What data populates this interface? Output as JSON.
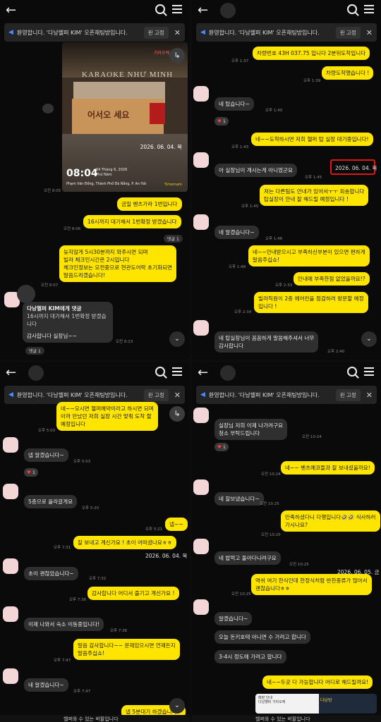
{
  "notice": {
    "text": "환영합니다. '다낭헬퍼 KIM' 오픈채팅방입니다.",
    "pin_label": "핀 고정",
    "close": "✕"
  },
  "icons": {
    "back": "←",
    "down": "⌄",
    "share": "↳"
  },
  "panel1": {
    "photo": {
      "sign": "KARAOKE NHƯ MINH",
      "counter_text": "어서오 세요",
      "lamp_text": "가라오케",
      "time": "08:04",
      "date_line1": "04 Tháng 6, 2026",
      "date_line2": "Thứ Năm",
      "address": "Phạm Văn Đồng, Thành Phố Đà Nẵng, P. An Hải",
      "mark": "Timemark",
      "date_overlay": "2026. 06. 04. 목"
    },
    "t_photo": "오전 8:05",
    "m1": "금일 벤츠가라 1번입니다",
    "m2": "16시까지 대기해서 1번확정 받겠습니다",
    "t_m2": "오전 8:06",
    "reply_count": "댓글 1",
    "m3": "늦지않게 5시30분까지 와주시면 되며\n빌라 체크인시간은 2시입니다\n체크인정보는 오전중으로 현관도어락 초기화되면\n말씀드리겠습니다!",
    "t_m3": "오전 8:07",
    "m4_head": "다낭헬퍼 KIM에게 댓글",
    "m4_quote": "16시까지 대기해서 1번확정 받겠습니다",
    "m4_body": "감사합니다 실장님~~",
    "t_m4": "오전 8:23",
    "reply_count2": "댓글 1"
  },
  "panel2": {
    "m1": "차량번호 43H 037.75 입니다 2분뒤도착입니다",
    "t_m1": "오후 1:37",
    "m2": "차량도착했습니다 !",
    "t_m2": "오후 1:39",
    "m3": "네 탔습니다~",
    "t_m3": "오후 1:40",
    "heart": "1",
    "m4": "네~~도착하시면 저희 헬퍼 탑 실장 대기중입니다!",
    "t_m4": "오후 1:43",
    "m5": "아 실장님이 계시는게 아니였군요",
    "t_m5": "오후 1:45",
    "date_box": "2026. 06. 04. 목",
    "m6": "저는 다른팀도 안내가 있어서ㅜㅜ 죄송합니다\n탑실장이 안내 잘 해드릴 예정입니다 !",
    "t_m6": "오후 1:45",
    "m7": "네 알겠습니다~",
    "t_m7": "오후 1:46",
    "m8": "네~~안내받으시고 부족하신부분이 있으면 편하게\n말씀주십쇼!",
    "t_m8": "오후 1:48",
    "m9": "안내에 부족한점 없었을까요!?",
    "t_m9": "오후 2:33",
    "m10": "빌라직원이 2층 에어컨을 점검하러 방문할 예정\n입니다 !",
    "t_m10": "오후 2:34",
    "m11": "네 탑실장님이 꼼꼼하게 말씀해주셔서 너무\n감사합니다",
    "t_m11": "오후 2:40"
  },
  "panel3": {
    "m1": "네~~오시면 헬퍼예약이라고 하시면 되며\n아까 만났던 저희 실장 시간 맞춰 도착 할\n예정입니다",
    "t_m1": "오후 5:03",
    "m2": "넵 알겠습니다~",
    "t_m2": "오후 5:03",
    "heart": "1",
    "m3": "5층으로 올라갈게요",
    "t_m3": "오후 5:20",
    "m4": "넵~~",
    "t_m4": "오후 5:21",
    "m5": "잘 보내고 계신가요 ! 초이 어떠셨나요ㅎㅎ",
    "t_m5": "오후 7:31",
    "date_ov": "2026. 06. 04. 목",
    "m6": "초이  괜찮았습니다~",
    "t_m6": "오후 7:32",
    "m7": "감사합니다  어디서 즐기고 계신가요 !",
    "t_m7": "오후 7:36",
    "m8": "이제 나와서 숙소 이동중입니다!",
    "t_m8": "오후 7:36",
    "m9": "말씀 감사합니다~~ 문제있으시면 언제든지\n말씀주십쇼!",
    "t_m9": "오후 7:47",
    "m10": "네 알겠습니다~",
    "t_m10": "오후 7:47",
    "m11": "넵 5분대기 하겠습니다~",
    "bottom": "헬퍼와 수 있는 버팔입니다"
  },
  "panel4": {
    "m1": "실장님 저희 이제 나가려구요\n청소 부탁드립니다",
    "t_m1": "오전 10:24",
    "heart": "1",
    "m2": "네~~  벤츠예코들과 잘 보내셨을까요!",
    "t_m2": "오전 10:24",
    "m3": "네 잘보냈습니다~",
    "t_m3": "오전 10:25",
    "m4": "만족하셨다니 다행입니다🤣🤣 식사하러\n가시나요?",
    "t_m4": "오전 10:25",
    "m5": "네 밥먹고 돌아다니려구요",
    "t_m5": "오전 10:25",
    "m6": "역쉬 여기 한식인데 한정식처럼 반찬종류가 많아서\n괜찮습니다ㅎㅎ",
    "t_m6": "오전 10:25",
    "date_ov": "2026. 06. 05. 금",
    "m7": "알겠습니다~",
    "m8": "오늘 돈키호테 아니면 수 가려고 합니다",
    "m9": "3-4시 정도에 가려고 합니다",
    "m10": "네~~두곳 다 가능합니다 어디로 해드릴까요!",
    "ad_text": "매장 안내\n다낭헬퍼 가라오케",
    "ad_right": "다낭방",
    "bottom": "헬퍼와 수 있는 버팔입니다"
  }
}
